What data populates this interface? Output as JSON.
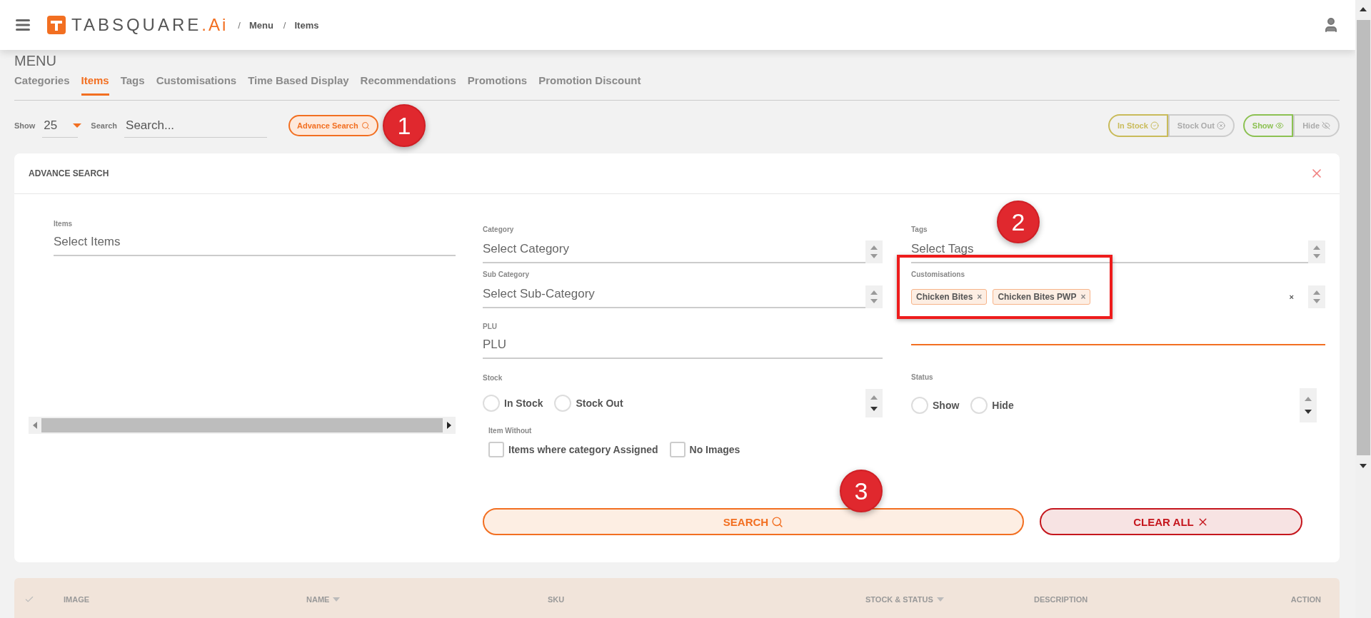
{
  "header": {
    "logo": {
      "name": "TABSQUARE",
      "suffix": ".Ai"
    },
    "breadcrumb": {
      "separator": "/",
      "items": [
        "Menu",
        "Items"
      ]
    }
  },
  "page_title": "MENU",
  "tabs": [
    {
      "label": "Categories",
      "selected": false
    },
    {
      "label": "Items",
      "selected": true
    },
    {
      "label": "Tags",
      "selected": false
    },
    {
      "label": "Customisations",
      "selected": false
    },
    {
      "label": "Time Based Display",
      "selected": false
    },
    {
      "label": "Recommendations",
      "selected": false
    },
    {
      "label": "Promotions",
      "selected": false
    },
    {
      "label": "Promotion Discount",
      "selected": false
    }
  ],
  "toolbar": {
    "show_label": "Show",
    "page_size": "25",
    "search_label": "Search",
    "search_placeholder": "Search...",
    "advance_search": "Advance Search",
    "filter_groups": [
      [
        {
          "label": "In Stock",
          "kind": "check",
          "selected": true,
          "color": "#c9bb5a"
        },
        {
          "label": "Stock Out",
          "kind": "cross",
          "selected": false
        }
      ],
      [
        {
          "label": "Show",
          "kind": "eye",
          "selected": true,
          "color": "#8cc152"
        },
        {
          "label": "Hide",
          "kind": "eye-off",
          "selected": false
        }
      ]
    ]
  },
  "advance_search": {
    "title": "ADVANCE SEARCH",
    "items": {
      "label": "Items",
      "placeholder": "Select Items"
    },
    "category": {
      "label": "Category",
      "placeholder": "Select Category"
    },
    "sub_category": {
      "label": "Sub Category",
      "placeholder": "Select Sub-Category"
    },
    "plu": {
      "label": "PLU",
      "placeholder": "PLU"
    },
    "tags": {
      "label": "Tags",
      "placeholder": "Select Tags"
    },
    "customisations": {
      "label": "Customisations",
      "chips": [
        "Chicken Bites",
        "Chicken Bites PWP"
      ],
      "chip_remove": "×",
      "clear": "×"
    },
    "stock": {
      "label": "Stock",
      "options": [
        {
          "label": "In Stock",
          "selected": false
        },
        {
          "label": "Stock Out",
          "selected": false
        }
      ]
    },
    "status": {
      "label": "Status",
      "options": [
        {
          "label": "Show",
          "selected": false
        },
        {
          "label": "Hide",
          "selected": false
        }
      ]
    },
    "item_without": {
      "label": "Item Without",
      "options": [
        {
          "label": "Items where category Assigned",
          "checked": false
        },
        {
          "label": "No Images",
          "checked": false
        }
      ]
    },
    "search_button": "SEARCH",
    "clear_button": "CLEAR ALL"
  },
  "table": {
    "columns": [
      {
        "label": "IMAGE",
        "sortable": false
      },
      {
        "label": "NAME",
        "sortable": true
      },
      {
        "label": "SKU",
        "sortable": false
      },
      {
        "label": "STOCK & STATUS",
        "sortable": true
      },
      {
        "label": "DESCRIPTION",
        "sortable": false
      },
      {
        "label": "ACTION",
        "sortable": false
      }
    ]
  },
  "annotations": [
    "1",
    "2",
    "3"
  ]
}
